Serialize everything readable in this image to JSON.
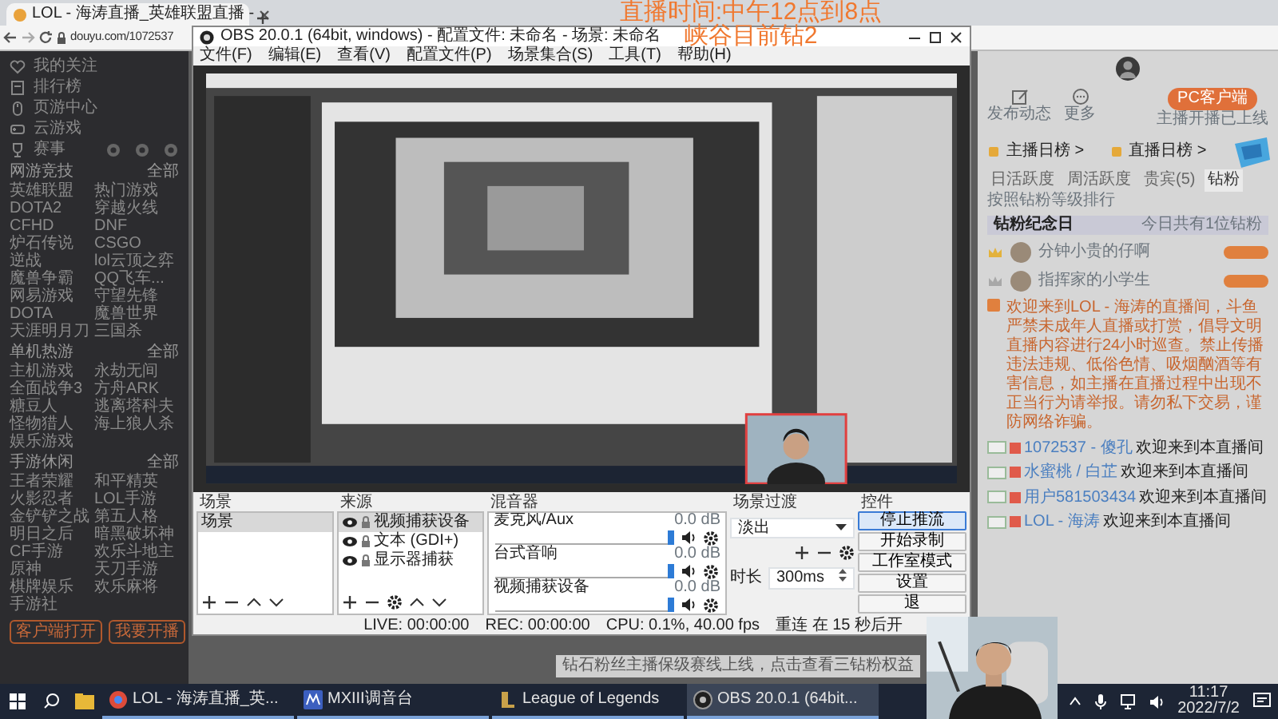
{
  "browser": {
    "tab_title": "LOL - 海涛直播_英雄联盟直播 -",
    "url": "douyu.com/1072537"
  },
  "overlay": [
    "直播时间:中午12点到8点",
    "峡谷目前钻2"
  ],
  "sidebar": {
    "nav": [
      "我的关注",
      "排行榜",
      "页游中心",
      "云游戏",
      "赛事"
    ],
    "sections": [
      {
        "title": "网游竞技",
        "more": "全部",
        "items": [
          "英雄联盟",
          "热门游戏",
          "DOTA2",
          "穿越火线",
          "CFHD",
          "DNF",
          "炉石传说",
          "CSGO",
          "逆战",
          "lol云顶之弈",
          "魔兽争霸",
          "QQ飞车...",
          "网易游戏",
          "守望先锋",
          "DOTA",
          "魔兽世界",
          "天涯明月刀",
          "三国杀"
        ]
      },
      {
        "title": "单机热游",
        "more": "全部",
        "items": [
          "主机游戏",
          "永劫无间",
          "全面战争3",
          "方舟ARK",
          "糖豆人",
          "逃离塔科夫",
          "怪物猎人",
          "海上狼人杀",
          "娱乐游戏"
        ]
      },
      {
        "title": "手游休闲",
        "more": "全部",
        "items": [
          "王者荣耀",
          "和平精英",
          "火影忍者",
          "LOL手游",
          "金铲铲之战",
          "第五人格",
          "明日之后",
          "暗黑破坏神",
          "CF手游",
          "欢乐斗地主",
          "原神",
          "天刀手游",
          "棋牌娱乐",
          "欢乐麻将",
          "手游社"
        ]
      }
    ],
    "buttons": [
      "客户端打开",
      "我要开播"
    ]
  },
  "right_panel": {
    "actions": [
      "发布动态",
      "更多"
    ],
    "client_button": "PC客户端",
    "client_note": "主播开播已上线",
    "ranks": [
      "主播日榜 >",
      "直播日榜 >"
    ],
    "tabs": [
      {
        "label": "日活跃度",
        "selected": false
      },
      {
        "label": "周活跃度",
        "selected": false
      },
      {
        "label": "贵宾(5)",
        "selected": false
      },
      {
        "label": "钻粉",
        "selected": true
      }
    ],
    "fan_hint": "按照钻粉等级排行",
    "fan_day": "钻粉纪念日",
    "fan_day_note": "今日共有1位钻粉",
    "fans": [
      {
        "name": "分钟小贵的仔啊",
        "color": "#e3b23c"
      },
      {
        "name": "指挥家的小学生",
        "color": "#a8a8a8"
      }
    ],
    "notice": "欢迎来到LOL - 海涛的直播间，斗鱼严禁未成年人直播或打赏，倡导文明直播内容进行24小时巡查。禁止传播违法违规、低俗色情、吸烟酗酒等有害信息，如主播在直播过程中出现不正当行为请举报。请勿私下交易，谨防网络诈骗。",
    "messages": [
      {
        "name": "1072537 - 傻孔",
        "text": "欢迎来到本直播间"
      },
      {
        "name": "水蜜桃 / 白芷",
        "text": "欢迎来到本直播间"
      },
      {
        "name": "用户581503434",
        "text": "欢迎来到本直播间"
      },
      {
        "name": "LOL - 海涛",
        "text": "欢迎来到本直播间"
      }
    ]
  },
  "obs": {
    "title": "OBS 20.0.1 (64bit, windows) - 配置文件: 未命名 - 场景: 未命名",
    "menu": [
      "文件(F)",
      "编辑(E)",
      "查看(V)",
      "配置文件(P)",
      "场景集合(S)",
      "工具(T)",
      "帮助(H)"
    ],
    "scenes": {
      "title": "场景",
      "items": [
        {
          "label": "场景",
          "selected": true
        }
      ]
    },
    "sources": {
      "title": "来源",
      "items": [
        {
          "label": "视频捕获设备",
          "selected": true
        },
        {
          "label": "文本 (GDI+)",
          "selected": false
        },
        {
          "label": "显示器捕获",
          "selected": false
        }
      ]
    },
    "mixer": {
      "title": "混音器",
      "channels": [
        {
          "name": "麦克风/Aux",
          "reading": "0.0 dB",
          "level": 1
        },
        {
          "name": "台式音响",
          "reading": "0.0 dB",
          "level": 1
        },
        {
          "name": "视频捕获设备",
          "reading": "0.0 dB",
          "level": 1
        }
      ]
    },
    "transitions": {
      "title": "场景过渡",
      "value": "淡出",
      "duration_label": "时长",
      "duration": "300ms"
    },
    "controls": {
      "title": "控件",
      "buttons": [
        {
          "label": "停止推流",
          "active": true
        },
        {
          "label": "开始录制",
          "active": false
        },
        {
          "label": "工作室模式",
          "active": false
        },
        {
          "label": "设置",
          "active": false
        },
        {
          "label": "退",
          "active": false
        }
      ]
    },
    "status": [
      "LIVE: 00:00:00",
      "REC: 00:00:00",
      "CPU: 0.1%, 40.00 fps",
      "重连 在 15 秒后开"
    ]
  },
  "toast": "钻石粉丝主播保级赛线上线，点击查看三钻粉权益",
  "taskbar": {
    "apps": [
      {
        "label": "LOL - 海涛直播_英...",
        "active": false
      },
      {
        "label": "MXIII调音台",
        "active": false
      },
      {
        "label": "League of Legends",
        "active": false
      },
      {
        "label": "OBS 20.0.1 (64bit...",
        "active": true
      }
    ],
    "time": "11:17",
    "date": "2022/7/2"
  }
}
